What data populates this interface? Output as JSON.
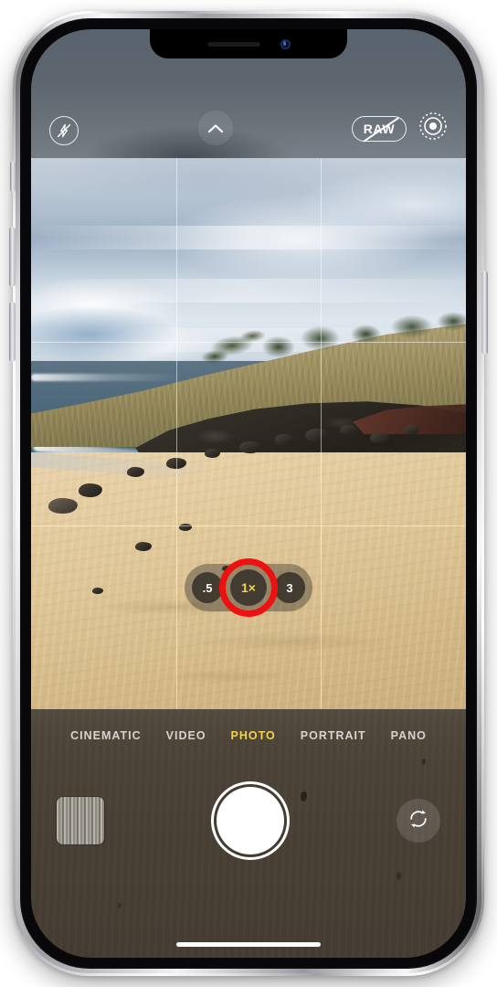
{
  "device": {
    "name": "iPhone",
    "notch": {
      "speaker": "earpiece-speaker",
      "camera": "front-camera"
    },
    "home_indicator": "home-indicator",
    "buttons": [
      "mute-switch",
      "volume-up",
      "volume-down",
      "side-button"
    ]
  },
  "app": {
    "name": "Camera",
    "top_controls": {
      "flash": {
        "icon": "flash-off-icon",
        "label": "Flash Off",
        "state": "off"
      },
      "more": {
        "icon": "chevron-up-icon",
        "label": "More Controls"
      },
      "raw": {
        "icon": "raw-off-icon",
        "label": "RAW",
        "state": "off"
      },
      "live_photo": {
        "icon": "live-photo-icon",
        "label": "Live Photo",
        "state": "on"
      }
    },
    "viewfinder": {
      "grid": "on",
      "scene": "beach-coastline-preview"
    },
    "zoom": {
      "selected": "1x",
      "options": [
        {
          "label": ".5",
          "value": "0.5x",
          "active": false
        },
        {
          "label": "1×",
          "value": "1x",
          "active": true
        },
        {
          "label": "3",
          "value": "3x",
          "active": false
        }
      ],
      "annotation": {
        "shape": "circle",
        "color": "#ee1111",
        "target": "1x"
      }
    },
    "modes": [
      {
        "label": "CINEMATIC",
        "active": false
      },
      {
        "label": "VIDEO",
        "active": false
      },
      {
        "label": "PHOTO",
        "active": true
      },
      {
        "label": "PORTRAIT",
        "active": false
      },
      {
        "label": "PANO",
        "active": false
      }
    ],
    "actions": {
      "thumbnail": {
        "name": "last-photo-thumbnail",
        "label": "Photo Library"
      },
      "shutter": {
        "name": "shutter-button",
        "label": "Take Photo"
      },
      "flip": {
        "icon": "camera-flip-icon",
        "label": "Switch Camera"
      }
    }
  },
  "colors": {
    "accent_yellow": "#f6d24a",
    "annotation_red": "#ee1111",
    "chrome_bg": "#483f34",
    "shutter_white": "#ffffff"
  }
}
